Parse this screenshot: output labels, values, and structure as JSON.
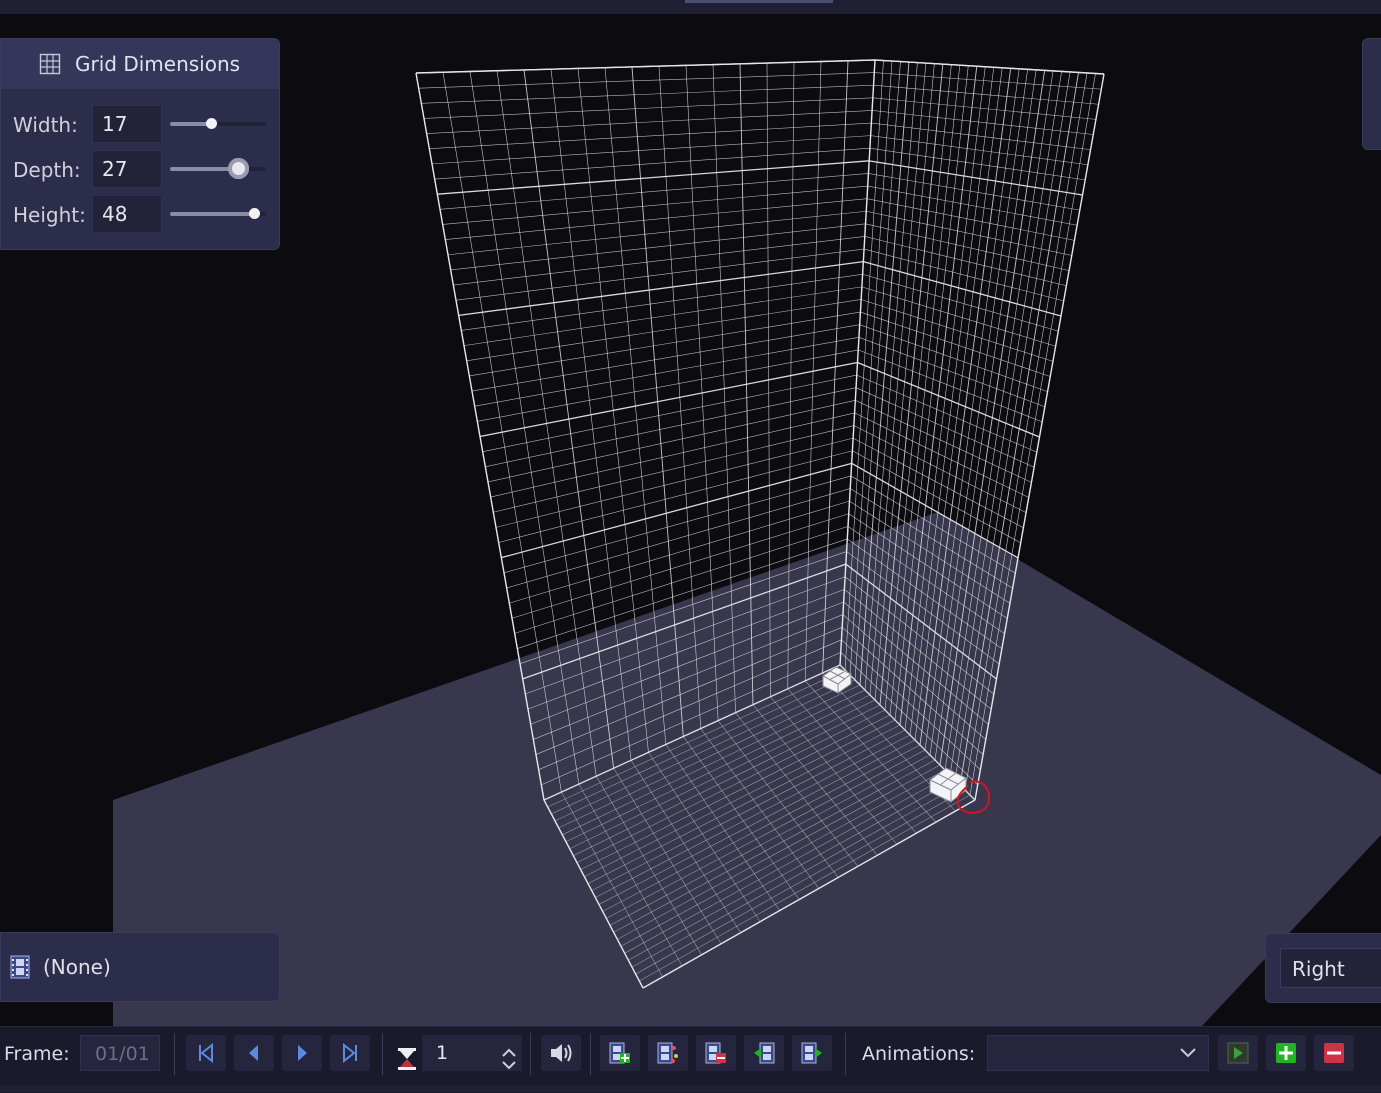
{
  "grid_panel": {
    "title": "Grid Dimensions",
    "icon": "grid-icon",
    "rows": [
      {
        "label": "Width:",
        "value": "17",
        "slider_fraction": 0.43
      },
      {
        "label": "Depth:",
        "value": "27",
        "slider_fraction": 0.71
      },
      {
        "label": "Height:",
        "value": "48",
        "slider_fraction": 0.87
      }
    ]
  },
  "animation_panel": {
    "icon": "film-strip-icon",
    "name": "(None)"
  },
  "view_panel": {
    "view_label": "Right"
  },
  "bottom_bar": {
    "frame_label": "Frame:",
    "frame_value": "01/01",
    "duration_value": "1",
    "animations_label": "Animations:",
    "animations_selected": ""
  },
  "colors": {
    "panel_bg": "#2b2d4a",
    "floor": "#38374d",
    "grid_lines": "#e8e8ec",
    "annotation_red": "#d4141e",
    "add_green": "#22b322",
    "remove_red": "#cc3344"
  }
}
